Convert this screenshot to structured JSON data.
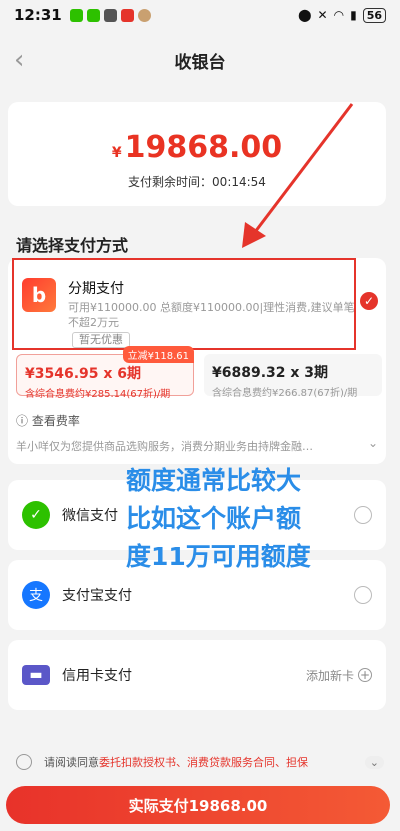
{
  "statusbar": {
    "time": "12:31",
    "battery": "56"
  },
  "nav": {
    "title": "收银台",
    "back_icon": "chevron-left"
  },
  "amount": {
    "currency": "¥",
    "value": "19868.00",
    "countdown": "支付剩余时间：00:14:54"
  },
  "section_title": "请选择支付方式",
  "installment": {
    "name": "分期支付",
    "description": "可用¥110000.00 总额度¥110000.00|理性消费,建议单笔不超2万元",
    "tag": "暂无优惠",
    "plans": [
      {
        "main": "¥3546.95 x 6期",
        "sub": "含综合息费约¥285.14(67折)/期",
        "promo": "立减¥118.61"
      },
      {
        "main": "¥6889.32 x 3期",
        "sub": "含综合息费约¥266.87(67折)/期"
      }
    ],
    "rate_link": "查看费率",
    "disclaimer": "羊小咩仅为您提供商品选购服务，消费分期业务由持牌金融…"
  },
  "methods": [
    {
      "label": "微信支付",
      "icon": "wechat-pay-icon"
    },
    {
      "label": "支付宝支付",
      "icon": "alipay-icon"
    },
    {
      "label": "信用卡支付",
      "icon": "credit-card-icon",
      "action": "添加新卡"
    }
  ],
  "overlay_text": [
    "额度通常比较大",
    "比如这个账户额",
    "度11万可用额度"
  ],
  "agreement": {
    "prefix": "请阅读同意",
    "links": "委托扣款授权书、消费贷款服务合同、担保"
  },
  "pay_button": "实际支付19868.00",
  "colors": {
    "accent": "#e5342b",
    "overlay": "#2a8de8"
  }
}
